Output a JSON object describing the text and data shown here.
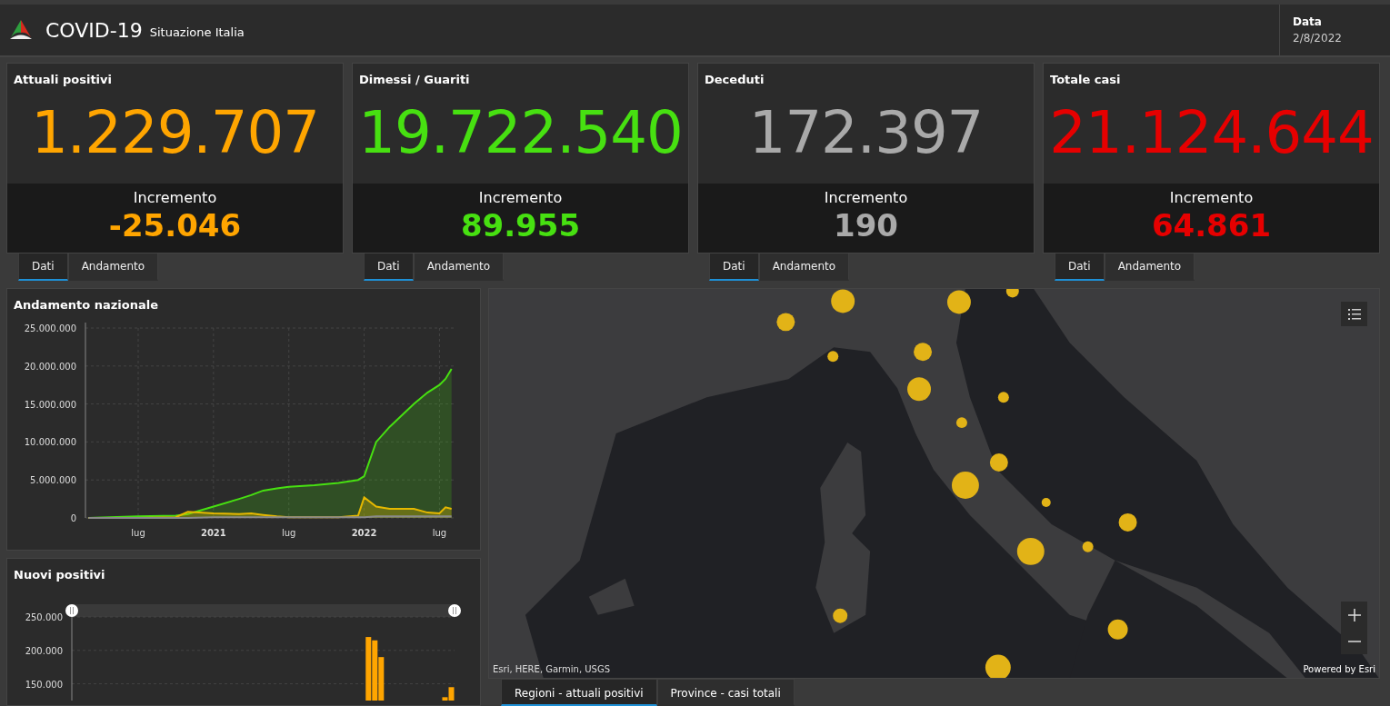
{
  "header": {
    "title": "COVID-19",
    "subtitle": "Situazione Italia",
    "date_label": "Data",
    "date_value": "2/8/2022"
  },
  "stats": [
    {
      "title": "Attuali positivi",
      "value": "1.229.707",
      "increment_label": "Incremento",
      "increment": "-25.046",
      "color": "#ffa500",
      "tabs": [
        {
          "label": "Dati",
          "selected": true
        },
        {
          "label": "Andamento",
          "selected": false
        }
      ]
    },
    {
      "title": "Dimessi / Guariti",
      "value": "19.722.540",
      "increment_label": "Incremento",
      "increment": "89.955",
      "color": "#47e011",
      "tabs": [
        {
          "label": "Dati",
          "selected": true
        },
        {
          "label": "Andamento",
          "selected": false
        }
      ]
    },
    {
      "title": "Deceduti",
      "value": "172.397",
      "increment_label": "Incremento",
      "increment": "190",
      "color": "#a9a9a9",
      "tabs": [
        {
          "label": "Dati",
          "selected": true
        },
        {
          "label": "Andamento",
          "selected": false
        }
      ]
    },
    {
      "title": "Totale casi",
      "value": "21.124.644",
      "increment_label": "Incremento",
      "increment": "64.861",
      "color": "#e60000",
      "tabs": [
        {
          "label": "Dati",
          "selected": true
        },
        {
          "label": "Andamento",
          "selected": false
        }
      ]
    }
  ],
  "trend_panel": {
    "title": "Andamento nazionale",
    "chart_data": {
      "type": "area",
      "grid": true,
      "x": [
        2020.17,
        2020.5,
        2020.75,
        2020.83,
        2021,
        2021.17,
        2021.25,
        2021.33,
        2021.42,
        2021.5,
        2021.67,
        2021.83,
        2021.96,
        2022,
        2022.08,
        2022.17,
        2022.33,
        2022.42,
        2022.5,
        2022.54,
        2022.58
      ],
      "xlim": [
        2020.15,
        2022.6
      ],
      "ylim": [
        0,
        25000000
      ],
      "yticks": [
        {
          "value": 0,
          "label": "0"
        },
        {
          "value": 5000000,
          "label": "5.000.000"
        },
        {
          "value": 10000000,
          "label": "10.000.000"
        },
        {
          "value": 15000000,
          "label": "15.000.000"
        },
        {
          "value": 20000000,
          "label": "20.000.000"
        },
        {
          "value": 25000000,
          "label": "25.000.000"
        }
      ],
      "xticks": [
        {
          "value": 2020.5,
          "label": "lug"
        },
        {
          "value": 2021,
          "label": "2021"
        },
        {
          "value": 2021.5,
          "label": "lug"
        },
        {
          "value": 2022,
          "label": "2022"
        },
        {
          "value": 2022.5,
          "label": "lug"
        }
      ],
      "series": [
        {
          "color": "#47e011",
          "values": [
            0,
            200000,
            300000,
            500000,
            1500000,
            2500000,
            3000000,
            3600000,
            3900000,
            4100000,
            4300000,
            4600000,
            5000000,
            5500000,
            10000000,
            12000000,
            15000000,
            16500000,
            17500000,
            18300000,
            19600000
          ]
        },
        {
          "color": "#e6b800",
          "values": [
            0,
            0,
            100000,
            800000,
            600000,
            500000,
            600000,
            400000,
            200000,
            100000,
            100000,
            100000,
            300000,
            2700000,
            1500000,
            1200000,
            1200000,
            700000,
            600000,
            1400000,
            1200000
          ]
        },
        {
          "color": "#8a8a8a",
          "values": [
            0,
            0,
            0,
            0,
            100000,
            100000,
            100000,
            100000,
            100000,
            100000,
            100000,
            100000,
            100000,
            100000,
            200000,
            200000,
            200000,
            200000,
            200000,
            200000,
            200000
          ]
        }
      ]
    }
  },
  "new_cases_panel": {
    "title": "Nuovi positivi",
    "chart_data": {
      "type": "bar",
      "grid": true,
      "categories": [
        null,
        null,
        null,
        null,
        null,
        null,
        null,
        null,
        null,
        null,
        null,
        null,
        null,
        null,
        null,
        null,
        null,
        null,
        null,
        null,
        null,
        null,
        null,
        null,
        null,
        null,
        null,
        null,
        null,
        null,
        null,
        null,
        null,
        null,
        null,
        null,
        null,
        null,
        null,
        null,
        null,
        null,
        null,
        null,
        null,
        null,
        null,
        null,
        null,
        null,
        null,
        null,
        null,
        null,
        null,
        null,
        null,
        null,
        null,
        null
      ],
      "ylim": [
        125000,
        250000
      ],
      "yticks": [
        {
          "value": 150000,
          "label": "150.000"
        },
        {
          "value": 200000,
          "label": "200.000"
        },
        {
          "value": 250000,
          "label": "250.000"
        }
      ],
      "series": [
        {
          "color": "#ffa500",
          "values": [
            null,
            null,
            null,
            null,
            null,
            null,
            null,
            null,
            null,
            null,
            null,
            null,
            null,
            null,
            null,
            null,
            null,
            null,
            null,
            null,
            null,
            null,
            null,
            null,
            null,
            null,
            null,
            null,
            null,
            null,
            null,
            null,
            null,
            null,
            null,
            null,
            null,
            null,
            null,
            null,
            null,
            null,
            null,
            null,
            null,
            null,
            220000,
            215000,
            190000,
            null,
            null,
            null,
            null,
            null,
            null,
            null,
            null,
            null,
            130000,
            145000
          ]
        }
      ]
    }
  },
  "map": {
    "kind": "picture",
    "attribution": "Esri, HERE, Garmin, USGS",
    "powered_by": "Powered by Esri",
    "tabs": [
      {
        "label": "Regioni - attuali positivi",
        "selected": true
      },
      {
        "label": "Province - casi totali",
        "selected": false
      }
    ]
  }
}
